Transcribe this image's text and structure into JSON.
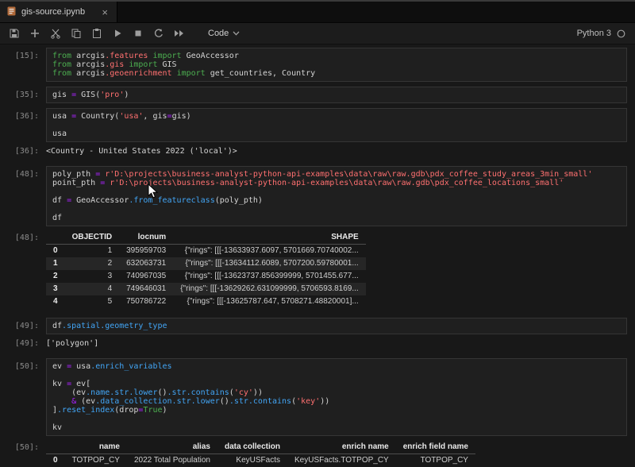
{
  "tab_bar": {
    "tab_title": "gis-source.ipynb",
    "close_label": "×"
  },
  "toolbar": {
    "buttons": [
      "save-icon",
      "add-cell-icon",
      "cut-icon",
      "copy-icon",
      "paste-icon",
      "run-icon",
      "stop-icon",
      "restart-kernel-icon",
      "fast-forward-icon"
    ],
    "cell_type_label": "Code",
    "kernel_label": "Python 3"
  },
  "colors": {
    "kw": "#4caf50",
    "str": "#ff7070",
    "mod": "#ff7070",
    "op": "#aa22ff",
    "prop": "#42a5f5",
    "plain": "#d4d4d4"
  },
  "cells": [
    {
      "type": "input",
      "prompt": "[15]:",
      "lines": [
        [
          [
            "kw",
            "from"
          ],
          [
            "plain",
            " arcgis"
          ],
          [
            "mod",
            ".features"
          ],
          [
            "kw",
            " import"
          ],
          [
            "plain",
            " GeoAccessor"
          ]
        ],
        [
          [
            "kw",
            "from"
          ],
          [
            "plain",
            " arcgis"
          ],
          [
            "mod",
            ".gis"
          ],
          [
            "kw",
            " import"
          ],
          [
            "plain",
            " GIS"
          ]
        ],
        [
          [
            "kw",
            "from"
          ],
          [
            "plain",
            " arcgis"
          ],
          [
            "mod",
            ".geoenrichment"
          ],
          [
            "kw",
            " import"
          ],
          [
            "plain",
            " get_countries, Country"
          ]
        ]
      ]
    },
    {
      "type": "input",
      "prompt": "[35]:",
      "lines": [
        [
          [
            "plain",
            "gis "
          ],
          [
            "op",
            "="
          ],
          [
            "plain",
            " GIS("
          ],
          [
            "str",
            "'pro'"
          ],
          [
            "plain",
            ")"
          ]
        ]
      ]
    },
    {
      "type": "input",
      "prompt": "[36]:",
      "lines": [
        [
          [
            "plain",
            "usa "
          ],
          [
            "op",
            "="
          ],
          [
            "plain",
            " Country("
          ],
          [
            "str",
            "'usa'"
          ],
          [
            "plain",
            ", gis"
          ],
          [
            "op",
            "="
          ],
          [
            "plain",
            "gis)"
          ]
        ],
        [],
        [
          [
            "plain",
            "usa"
          ]
        ]
      ]
    },
    {
      "type": "output_text",
      "prompt": "[36]:",
      "text": "<Country - United States 2022 ('local')>"
    },
    {
      "type": "input",
      "prompt": "[48]:",
      "lines": [
        [
          [
            "plain",
            "poly_pth "
          ],
          [
            "op",
            "="
          ],
          [
            "plain",
            " "
          ],
          [
            "str",
            "r'D:\\projects\\business-analyst-python-api-examples\\data\\raw\\raw.gdb\\pdx_coffee_study_areas_3min_small'"
          ]
        ],
        [
          [
            "plain",
            "point_pth "
          ],
          [
            "op",
            "="
          ],
          [
            "plain",
            " "
          ],
          [
            "str",
            "r'D:\\projects\\business-analyst-python-api-examples\\data\\raw\\raw.gdb\\pdx_coffee_locations_small'"
          ]
        ],
        [],
        [
          [
            "plain",
            "df "
          ],
          [
            "op",
            "="
          ],
          [
            "plain",
            " GeoAccessor"
          ],
          [
            "prop",
            ".from_featureclass"
          ],
          [
            "plain",
            "(poly_pth)"
          ]
        ],
        [],
        [
          [
            "plain",
            "df"
          ]
        ]
      ]
    },
    {
      "type": "output_table",
      "prompt": "[48]:",
      "columns": [
        "",
        "OBJECTID",
        "locnum",
        "SHAPE"
      ],
      "rows": [
        [
          "0",
          "1",
          "395959703",
          "{\"rings\": [[[-13633937.6097, 5701669.70740002..."
        ],
        [
          "1",
          "2",
          "632063731",
          "{\"rings\": [[[-13634112.6089, 5707200.59780001..."
        ],
        [
          "2",
          "3",
          "740967035",
          "{\"rings\": [[[-13623737.856399999, 5701455.677..."
        ],
        [
          "3",
          "4",
          "749646031",
          "{\"rings\": [[[-13629262.631099999, 5706593.8169..."
        ],
        [
          "4",
          "5",
          "750786722",
          "{\"rings\": [[[-13625787.647, 5708271.48820001]..."
        ]
      ]
    },
    {
      "type": "input",
      "prompt": "[49]:",
      "lines": [
        [
          [
            "plain",
            "df"
          ],
          [
            "prop",
            ".spatial.geometry_type"
          ]
        ]
      ]
    },
    {
      "type": "output_text",
      "prompt": "[49]:",
      "text": "['polygon']"
    },
    {
      "type": "input",
      "prompt": "[50]:",
      "lines": [
        [
          [
            "plain",
            "ev "
          ],
          [
            "op",
            "="
          ],
          [
            "plain",
            " usa"
          ],
          [
            "prop",
            ".enrich_variables"
          ]
        ],
        [],
        [
          [
            "plain",
            "kv "
          ],
          [
            "op",
            "="
          ],
          [
            "plain",
            " ev["
          ]
        ],
        [
          [
            "plain",
            "    (ev"
          ],
          [
            "prop",
            ".name.str.lower"
          ],
          [
            "plain",
            "()"
          ],
          [
            "prop",
            ".str.contains"
          ],
          [
            "plain",
            "("
          ],
          [
            "str",
            "'cy'"
          ],
          [
            "plain",
            "))"
          ]
        ],
        [
          [
            "plain",
            "    "
          ],
          [
            "op",
            "&"
          ],
          [
            "plain",
            " (ev"
          ],
          [
            "prop",
            ".data_collection.str.lower"
          ],
          [
            "plain",
            "()"
          ],
          [
            "prop",
            ".str.contains"
          ],
          [
            "plain",
            "("
          ],
          [
            "str",
            "'key'"
          ],
          [
            "plain",
            "))"
          ]
        ],
        [
          [
            "plain",
            "]"
          ],
          [
            "prop",
            ".reset_index"
          ],
          [
            "plain",
            "(drop"
          ],
          [
            "op",
            "="
          ],
          [
            "kw",
            "True"
          ],
          [
            "plain",
            ")"
          ]
        ],
        [],
        [
          [
            "plain",
            "kv"
          ]
        ]
      ]
    },
    {
      "type": "output_table",
      "prompt": "[50]:",
      "columns": [
        "",
        "name",
        "alias",
        "data collection",
        "enrich name",
        "enrich field name"
      ],
      "rows": [
        [
          "0",
          "TOTPOP_CY",
          "2022 Total Population",
          "KeyUSFacts",
          "KeyUSFacts.TOTPOP_CY",
          "TOTPOP_CY"
        ]
      ]
    }
  ]
}
